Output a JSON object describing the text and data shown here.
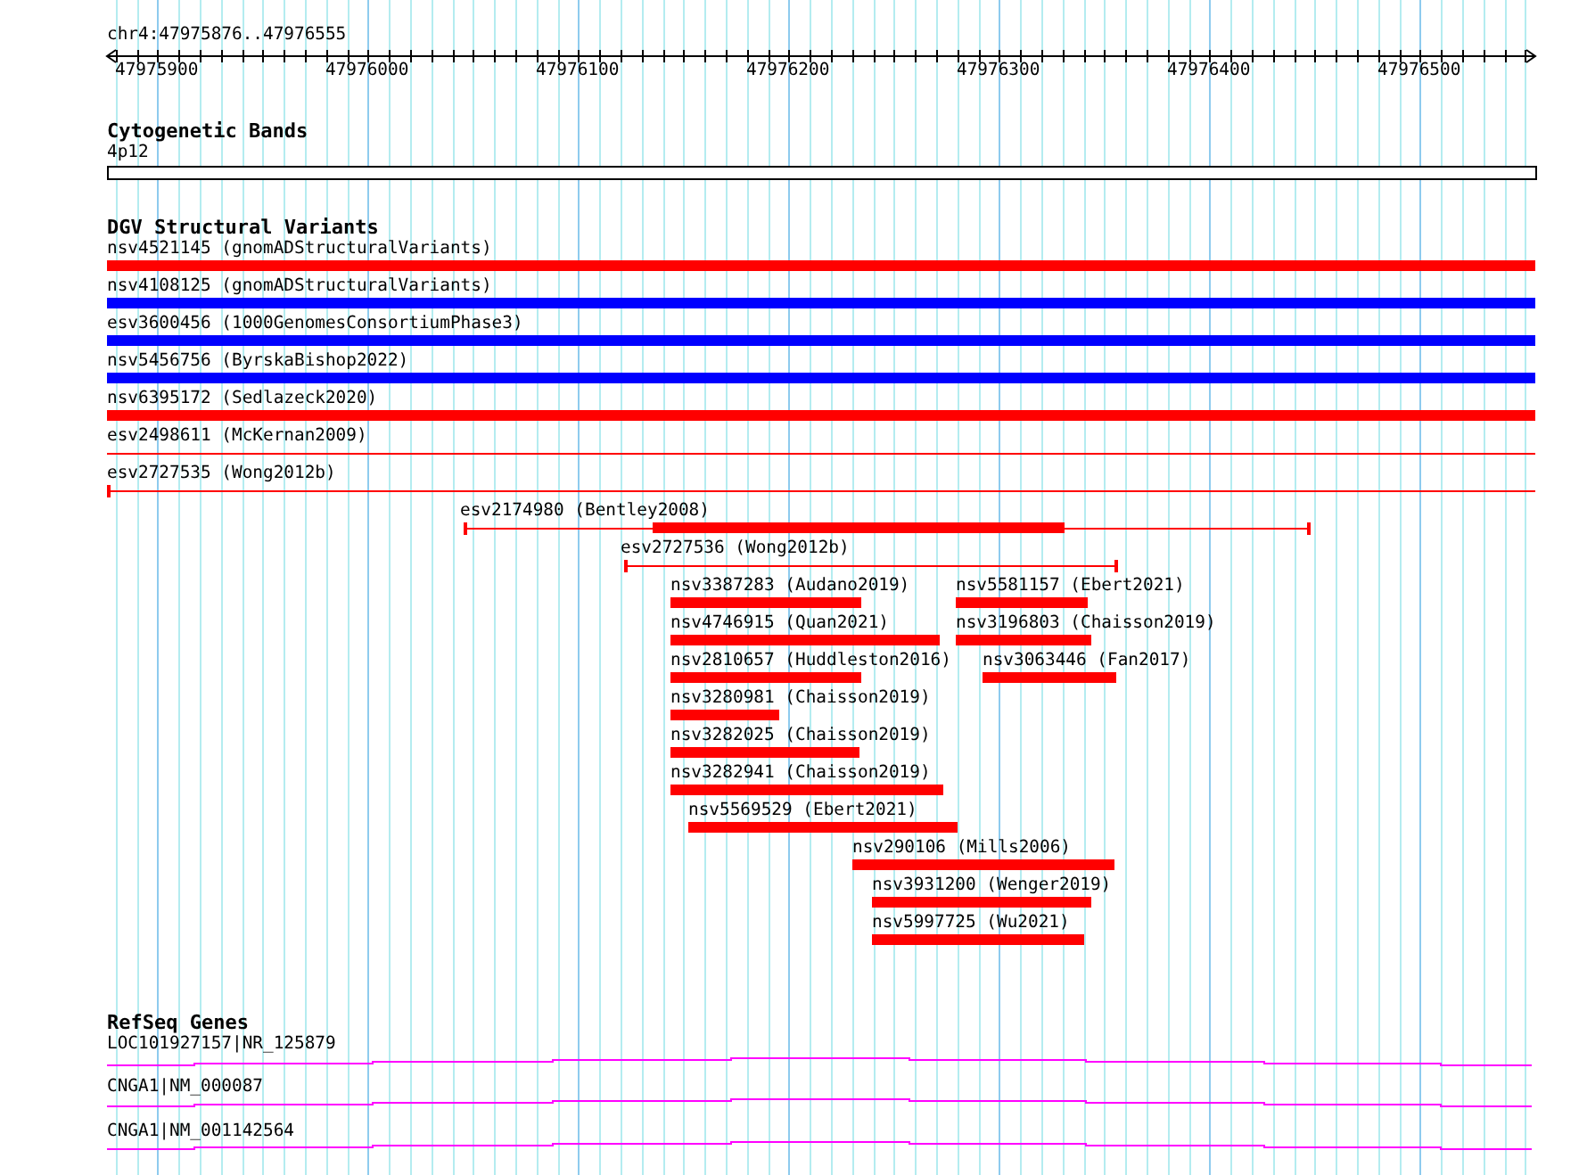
{
  "location": "chr4:47975876..47976555",
  "ruler": {
    "ticks": [
      "47975900",
      "47976000",
      "47976100",
      "47976200",
      "47976300",
      "47976400",
      "47976500"
    ]
  },
  "tracks": [
    {
      "title": "Cytogenetic Bands",
      "features": [
        {
          "label": "4p12",
          "kind": "band"
        }
      ]
    },
    {
      "title": "DGV Structural Variants",
      "features": [
        {
          "label": "nsv4521145 (gnomADStructuralVariants)",
          "kind": "bar",
          "color": "#ff0000"
        },
        {
          "label": "nsv4108125 (gnomADStructuralVariants)",
          "kind": "bar",
          "color": "#0000ff"
        },
        {
          "label": "esv3600456 (1000GenomesConsortiumPhase3)",
          "kind": "bar",
          "color": "#0000ff"
        },
        {
          "label": "nsv5456756 (ByrskaBishop2022)",
          "kind": "bar",
          "color": "#0000ff"
        },
        {
          "label": "nsv6395172 (Sedlazeck2020)",
          "kind": "bar",
          "color": "#ff0000"
        },
        {
          "label": "esv2498611 (McKernan2009)",
          "kind": "line",
          "color": "#ff0000"
        },
        {
          "label": "esv2727535 (Wong2012b)",
          "kind": "line",
          "color": "#ff0000"
        },
        {
          "label": "esv2174980 (Bentley2008)",
          "kind": "bar-line",
          "color": "#ff0000"
        },
        {
          "label": "esv2727536 (Wong2012b)",
          "kind": "line",
          "color": "#ff0000"
        },
        {
          "label": "nsv3387283 (Audano2019)",
          "kind": "bar",
          "color": "#ff0000"
        },
        {
          "label": "nsv5581157 (Ebert2021)",
          "kind": "bar",
          "color": "#ff0000"
        },
        {
          "label": "nsv4746915 (Quan2021)",
          "kind": "bar",
          "color": "#ff0000"
        },
        {
          "label": "nsv3196803 (Chaisson2019)",
          "kind": "bar",
          "color": "#ff0000"
        },
        {
          "label": "nsv2810657 (Huddleston2016)",
          "kind": "bar",
          "color": "#ff0000"
        },
        {
          "label": "nsv3063446 (Fan2017)",
          "kind": "bar",
          "color": "#ff0000"
        },
        {
          "label": "nsv3280981 (Chaisson2019)",
          "kind": "bar",
          "color": "#ff0000"
        },
        {
          "label": "nsv3282025 (Chaisson2019)",
          "kind": "bar",
          "color": "#ff0000"
        },
        {
          "label": "nsv3282941 (Chaisson2019)",
          "kind": "bar",
          "color": "#ff0000"
        },
        {
          "label": "nsv5569529 (Ebert2021)",
          "kind": "bar",
          "color": "#ff0000"
        },
        {
          "label": "nsv290106 (Mills2006)",
          "kind": "bar",
          "color": "#ff0000"
        },
        {
          "label": "nsv3931200 (Wenger2019)",
          "kind": "bar",
          "color": "#ff0000"
        },
        {
          "label": "nsv5997725 (Wu2021)",
          "kind": "bar",
          "color": "#ff0000"
        }
      ]
    },
    {
      "title": "RefSeq Genes",
      "features": [
        {
          "label": "LOC101927157|NR_125879",
          "kind": "gene"
        },
        {
          "label": "CNGA1|NM_000087",
          "kind": "gene"
        },
        {
          "label": "CNGA1|NM_001142564",
          "kind": "gene"
        }
      ]
    }
  ]
}
